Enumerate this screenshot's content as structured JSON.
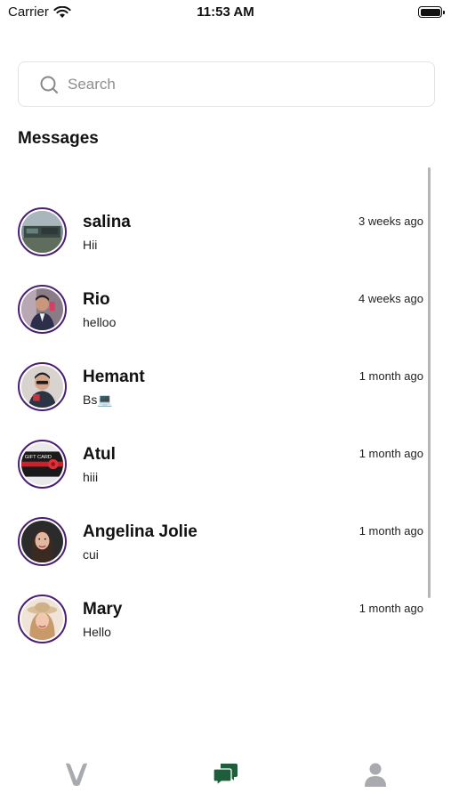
{
  "status_bar": {
    "carrier": "Carrier",
    "time": "11:53 AM"
  },
  "search": {
    "placeholder": "Search",
    "value": ""
  },
  "section_title": "Messages",
  "colors": {
    "avatar_ring": "#4a1e72",
    "active_tab": "#1f5e3a",
    "inactive_tab": "#a9a9b0"
  },
  "conversations": [
    {
      "name": "salina",
      "last_message": "Hii",
      "time": "3 weeks ago",
      "avatar": "landscape-photo"
    },
    {
      "name": "Rio",
      "last_message": "helloo",
      "time": "4 weeks ago",
      "avatar": "man-suit-photo"
    },
    {
      "name": "Hemant",
      "last_message": "Bs💻",
      "time": "1 month ago",
      "avatar": "man-photo"
    },
    {
      "name": "Atul",
      "last_message": "hiii",
      "time": "1 month ago",
      "avatar": "gift-card-photo"
    },
    {
      "name": "Angelina Jolie",
      "last_message": "cui",
      "time": "1 month ago",
      "avatar": "woman-photo"
    },
    {
      "name": "Mary",
      "last_message": "Hello",
      "time": "1 month ago",
      "avatar": "woman-hat-photo"
    }
  ],
  "gift_card_text": "GIFT CARD",
  "tabs": [
    {
      "name": "home",
      "icon": "app-logo-icon",
      "active": false
    },
    {
      "name": "messages",
      "icon": "chat-bubbles-icon",
      "active": true
    },
    {
      "name": "profile",
      "icon": "person-icon",
      "active": false
    }
  ]
}
